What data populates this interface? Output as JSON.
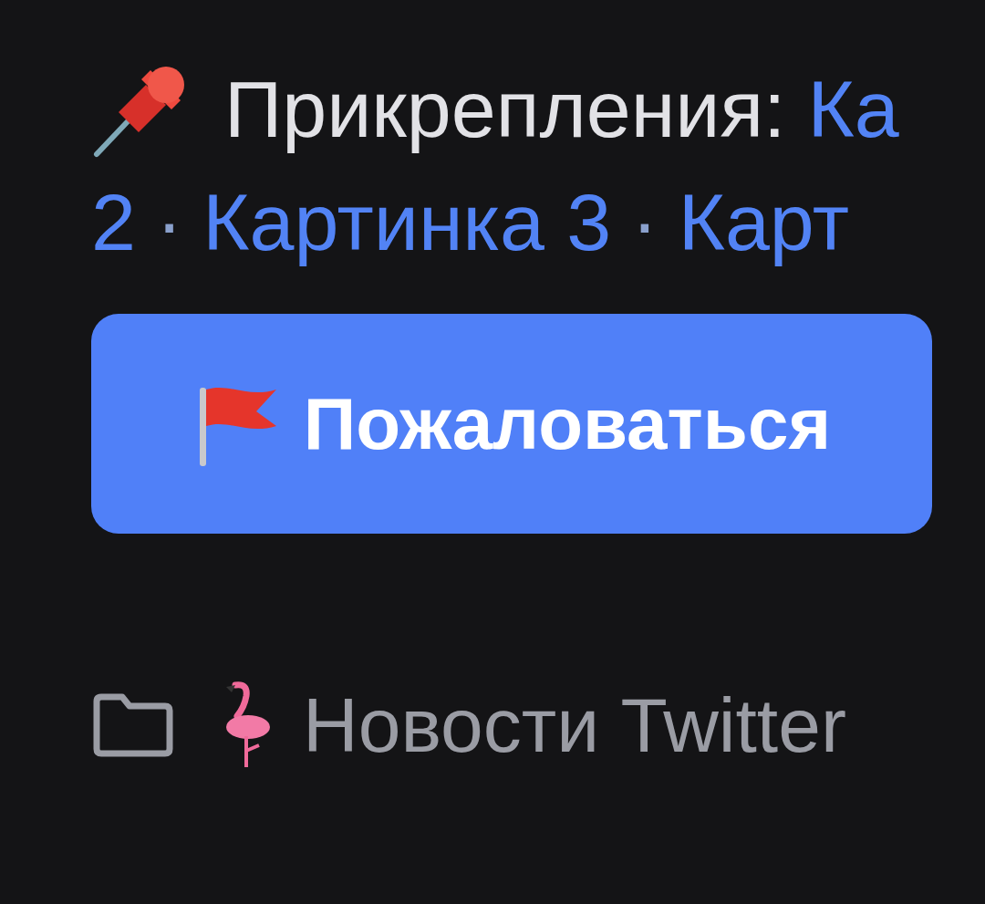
{
  "attachments": {
    "label": "Прикрепления:",
    "separator": "·",
    "lines": [
      [
        "Ка"
      ],
      [
        "2",
        "Картинка 3",
        "Карт"
      ]
    ]
  },
  "report_button": {
    "label": "Пожаловаться"
  },
  "folder": {
    "label": "Новости Twitter"
  }
}
